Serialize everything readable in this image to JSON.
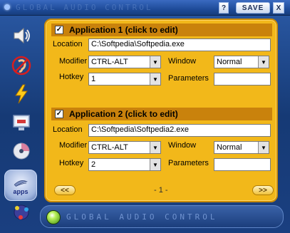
{
  "window": {
    "title": "GLOBAL AUDIO CONTROL",
    "help_label": "?",
    "save_label": "SAVE",
    "close_label": "X"
  },
  "sidebar": {
    "items": [
      {
        "icon": "speaker-icon"
      },
      {
        "icon": "ear-muted-icon"
      },
      {
        "icon": "lightning-icon"
      },
      {
        "icon": "monitor-dsd-icon"
      },
      {
        "icon": "cd-icon"
      },
      {
        "icon": "apps-icon",
        "label": "apps",
        "active": true
      },
      {
        "icon": "network-icon"
      }
    ]
  },
  "applications": [
    {
      "header": "Application 1 (click to edit)",
      "checked": true,
      "location_label": "Location",
      "location_value": "C:\\Softpedia\\Softpedia.exe",
      "modifier_label": "Modifier",
      "modifier_value": "CTRL-ALT",
      "window_label": "Window",
      "window_value": "Normal",
      "hotkey_label": "Hotkey",
      "hotkey_value": "1",
      "parameters_label": "Parameters",
      "parameters_value": ""
    },
    {
      "header": "Application 2 (click to edit)",
      "checked": true,
      "location_label": "Location",
      "location_value": "C:\\Softpedia\\Softpedia2.exe",
      "modifier_label": "Modifier",
      "modifier_value": "CTRL-ALT",
      "window_label": "Window",
      "window_value": "Normal",
      "hotkey_label": "Hotkey",
      "hotkey_value": "2",
      "parameters_label": "Parameters",
      "parameters_value": ""
    }
  ],
  "pager": {
    "prev_label": "<<",
    "next_label": ">>",
    "page_indicator": "- 1 -"
  },
  "bottombar": {
    "text": "GLOBAL AUDIO CONTROL"
  },
  "colors": {
    "panel": "#f2b81a",
    "section_header": "#c9820c",
    "frame": "#1d3f78"
  }
}
